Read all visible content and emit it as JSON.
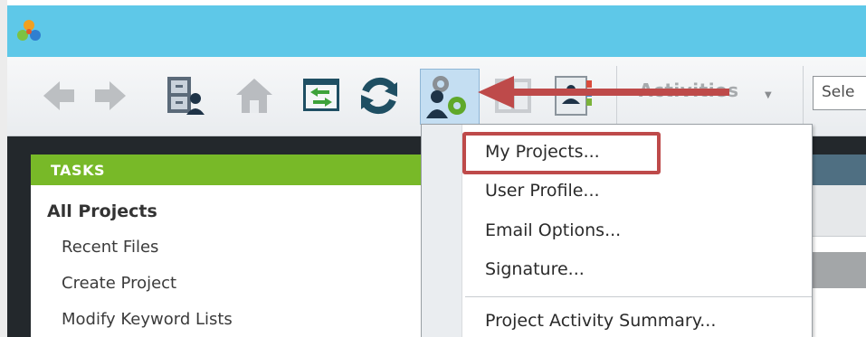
{
  "toolbar": {
    "activities_label": "Activities",
    "select_placeholder": "Sele"
  },
  "tasks": {
    "header": "TASKS",
    "group": "All Projects",
    "items": [
      "Recent Files",
      "Create Project",
      "Modify Keyword Lists"
    ]
  },
  "menu": {
    "items": [
      "My Projects...",
      "User Profile...",
      "Email Options...",
      "Signature...",
      "Project Activity Summary..."
    ]
  },
  "colors": {
    "titlebar": "#5ec8e8",
    "tasks_header": "#78b928",
    "highlight": "#be4a4a",
    "dark_band": "#23282c"
  },
  "icons": [
    "app-logo-icon",
    "back-arrow-icon",
    "forward-arrow-icon",
    "file-cabinet-icon",
    "home-icon",
    "transfer-window-icon",
    "refresh-icon",
    "user-settings-icon",
    "book-icon",
    "address-book-icon"
  ]
}
